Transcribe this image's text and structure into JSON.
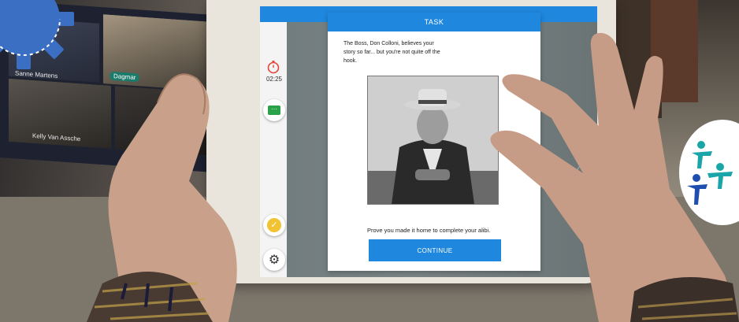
{
  "video_call": {
    "participants": [
      {
        "name": "Dagmar"
      },
      {
        "name": "Sanne Martens"
      },
      {
        "name": "Kelly Van Assche"
      }
    ]
  },
  "app": {
    "timer": "02:25",
    "dialog": {
      "header": "TASK",
      "message": "The Boss, Don Colloni, believes your story so far... but you're not quite off the hook.",
      "prompt": "Prove you made it home to complete your alibi.",
      "continue_label": "CONTINUE"
    }
  },
  "icons": {
    "timer": "stopwatch-icon",
    "hint": "chat-bubble-icon",
    "check": "check-circle-icon",
    "settings": "gear-icon",
    "logo": "gear-logo-icon",
    "badge": "acrobat-figures-logo"
  },
  "colors": {
    "primary_blue": "#1f87dd",
    "timer_red": "#e3473b",
    "hint_green": "#2aa24a",
    "check_yellow": "#f1c232",
    "logo_blue": "#3a6fc4",
    "badge_teal": "#1aa6a8"
  }
}
